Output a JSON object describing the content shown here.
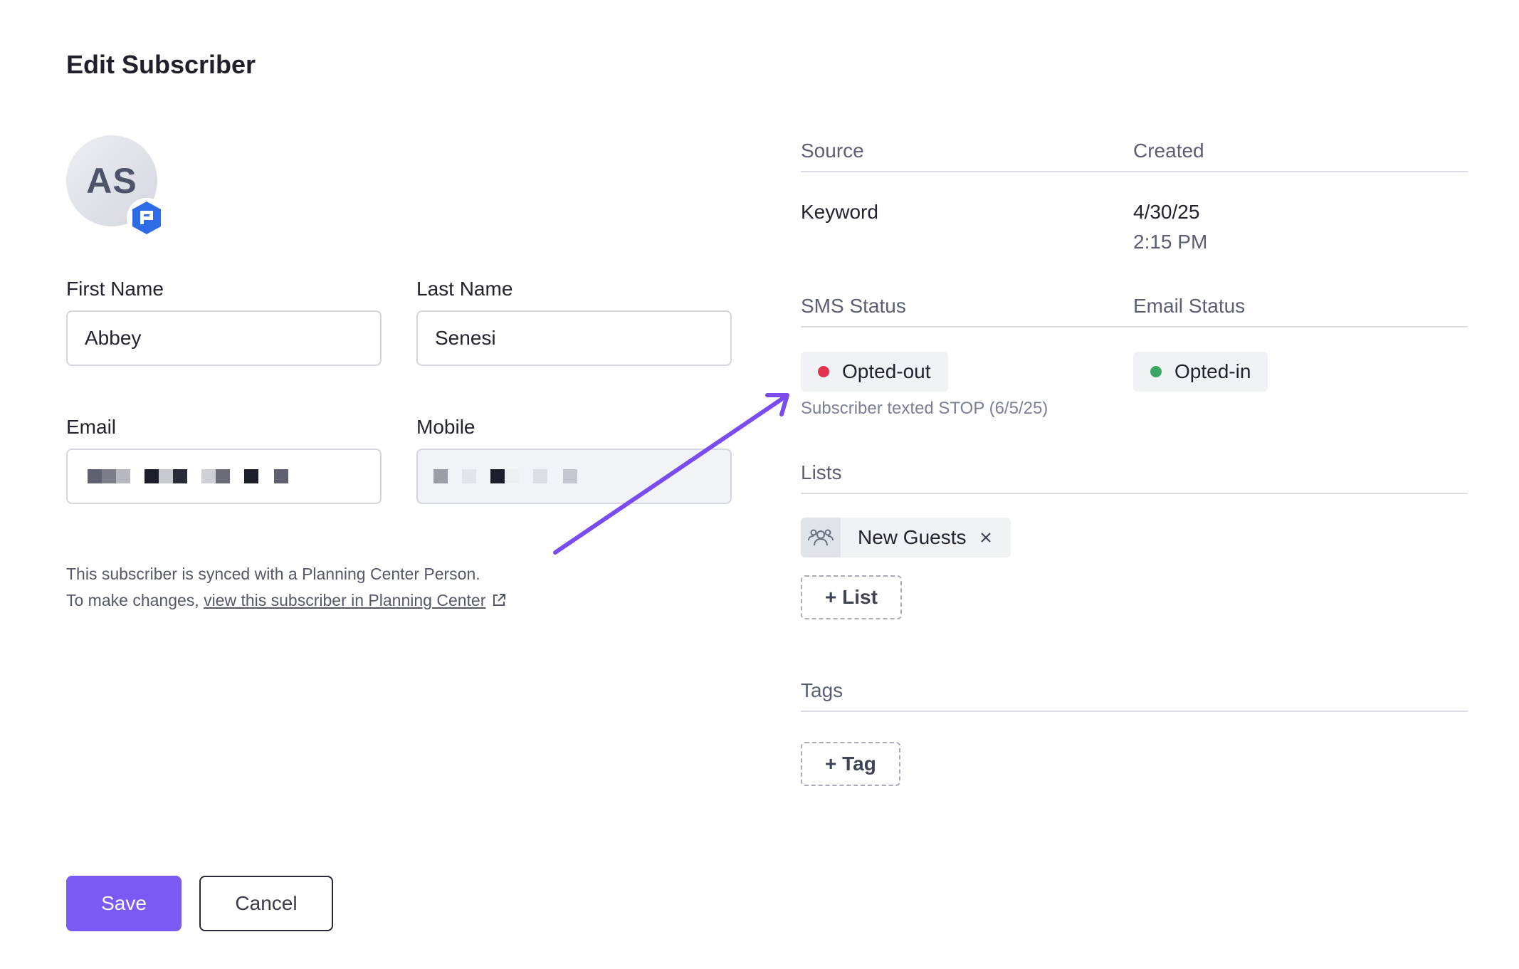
{
  "page": {
    "title": "Edit Subscriber"
  },
  "avatar": {
    "initials": "AS",
    "badge_icon": "planning-center-icon"
  },
  "form": {
    "first_name": {
      "label": "First Name",
      "value": "Abbey"
    },
    "last_name": {
      "label": "Last Name",
      "value": "Senesi"
    },
    "email": {
      "label": "Email",
      "value_redacted": true
    },
    "mobile": {
      "label": "Mobile",
      "value_redacted": true
    }
  },
  "sync_note": {
    "line1": "This subscriber is synced with a Planning Center Person.",
    "line2_prefix": "To make changes, ",
    "link_text": "view this subscriber in Planning Center",
    "link_icon": "external-link-icon"
  },
  "actions": {
    "save_label": "Save",
    "cancel_label": "Cancel"
  },
  "details": {
    "source": {
      "label": "Source",
      "value": "Keyword"
    },
    "created": {
      "label": "Created",
      "date": "4/30/25",
      "time": "2:15 PM"
    }
  },
  "status": {
    "sms": {
      "label": "SMS Status",
      "value": "Opted-out",
      "color": "#e0344f",
      "note": "Subscriber texted STOP (6/5/25)"
    },
    "email": {
      "label": "Email Status",
      "value": "Opted-in",
      "color": "#3aa565"
    }
  },
  "lists": {
    "label": "Lists",
    "items": [
      {
        "name": "New Guests",
        "icon": "people-group-icon"
      }
    ],
    "add_label": "+ List"
  },
  "tags": {
    "label": "Tags",
    "items": [],
    "add_label": "+ Tag"
  },
  "colors": {
    "accent": "#7a5af5",
    "annotation_arrow": "#7a4cf0"
  }
}
